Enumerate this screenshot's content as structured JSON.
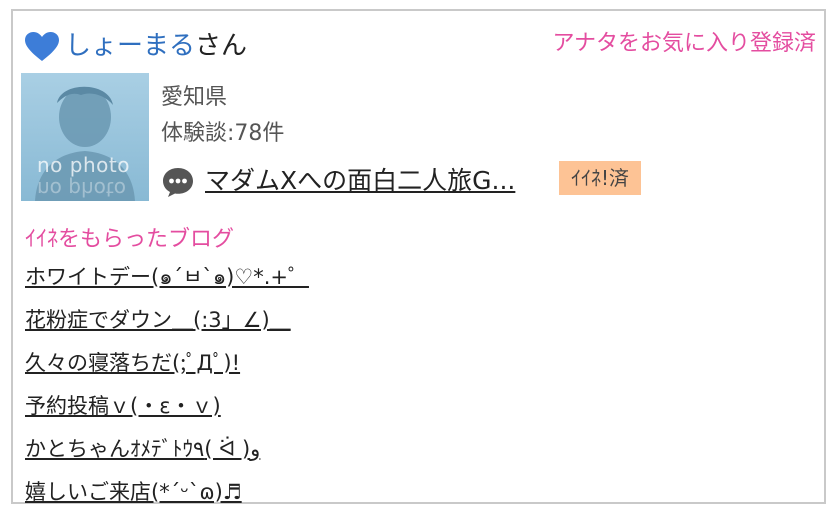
{
  "profile": {
    "name": "しょーまる",
    "honorific": "さん",
    "favorite_label": "アナタをお気に入り登録済",
    "prefecture": "愛知県",
    "review_count": "体験談:78件",
    "avatar_text": "no photo",
    "heart_color": "#3d7dd8"
  },
  "latest": {
    "title": "マダムXへの面白二人旅G...",
    "badge": "ｲｲﾈ!済",
    "badge_color": "#fdc395"
  },
  "liked_blogs": {
    "heading": "ｲｲﾈをもらったブログ",
    "items": [
      "ホワイトデー(๑´ㅂ`๑)♡*.+゜",
      "花粉症でダウン＿(:3」∠)＿",
      "久々の寝落ちだ(;ﾟДﾟ)!",
      "予約投稿ｖ(・ε・ｖ)",
      "かとちゃんｵﾒﾃﾞﾄｳ٩( ᐛ )و",
      "嬉しいご来店(*´ᵕ`ɷ)♬"
    ]
  },
  "colors": {
    "link_blue": "#2f6fbf",
    "accent_pink": "#e44da0"
  }
}
